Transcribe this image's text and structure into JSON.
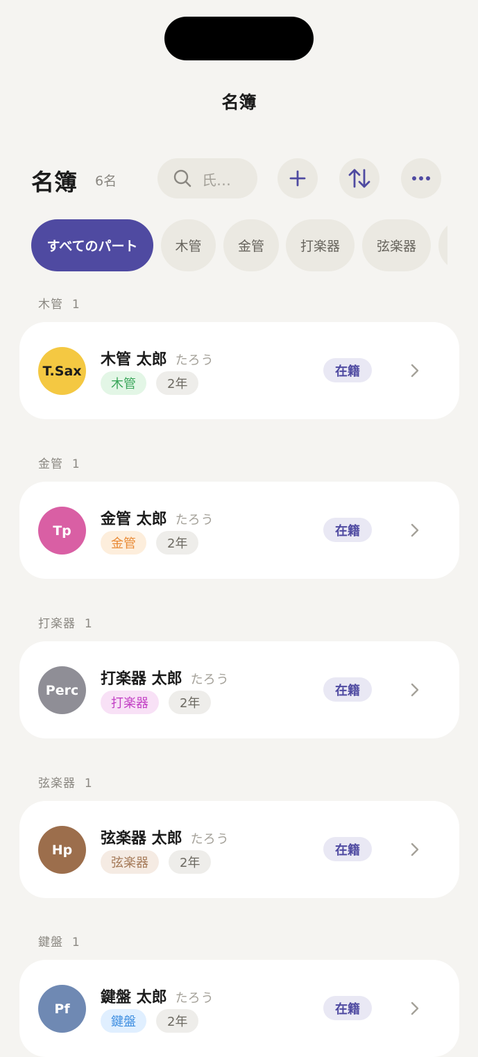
{
  "nav": {
    "title": "名簿"
  },
  "header": {
    "title": "名簿",
    "count": "6名",
    "search_placeholder": "氏…",
    "icons": [
      "search-icon",
      "plus-icon",
      "sort-icon",
      "more-icon"
    ]
  },
  "filters": [
    {
      "label": "すべてのパート",
      "active": true
    },
    {
      "label": "木管"
    },
    {
      "label": "金管"
    },
    {
      "label": "打楽器"
    },
    {
      "label": "弦楽器"
    },
    {
      "label": ""
    }
  ],
  "sections": [
    {
      "label": "木管",
      "count": "1",
      "member": {
        "avatar": "T.Sax",
        "avatar_color": "#f4c842",
        "avatar_text_color": "#1c1c1c",
        "name": "木管 太郎",
        "kana": "たろう",
        "part": "木管",
        "part_bg": "#e3f6e6",
        "part_color": "#3aa65a",
        "grade": "2年",
        "status": "在籍"
      }
    },
    {
      "label": "金管",
      "count": "1",
      "member": {
        "avatar": "Tp",
        "avatar_color": "#d95fa4",
        "avatar_text_color": "#ffffff",
        "name": "金管 太郎",
        "kana": "たろう",
        "part": "金管",
        "part_bg": "#fdeedc",
        "part_color": "#e98a35",
        "grade": "2年",
        "status": "在籍"
      }
    },
    {
      "label": "打楽器",
      "count": "1",
      "member": {
        "avatar": "Perc",
        "avatar_color": "#8f8e96",
        "avatar_text_color": "#ffffff",
        "name": "打楽器 太郎",
        "kana": "たろう",
        "part": "打楽器",
        "part_bg": "#f8e1f6",
        "part_color": "#c23fc4",
        "grade": "2年",
        "status": "在籍"
      }
    },
    {
      "label": "弦楽器",
      "count": "1",
      "member": {
        "avatar": "Hp",
        "avatar_color": "#9c6e4c",
        "avatar_text_color": "#ffffff",
        "name": "弦楽器 太郎",
        "kana": "たろう",
        "part": "弦楽器",
        "part_bg": "#f5ebe3",
        "part_color": "#a57a58",
        "grade": "2年",
        "status": "在籍"
      }
    },
    {
      "label": "鍵盤",
      "count": "1",
      "member": {
        "avatar": "Pf",
        "avatar_color": "#6f89b3",
        "avatar_text_color": "#ffffff",
        "name": "鍵盤 太郎",
        "kana": "たろう",
        "part": "鍵盤",
        "part_bg": "#e0efff",
        "part_color": "#3e8ee0",
        "grade": "2年",
        "status": "在籍"
      }
    }
  ]
}
